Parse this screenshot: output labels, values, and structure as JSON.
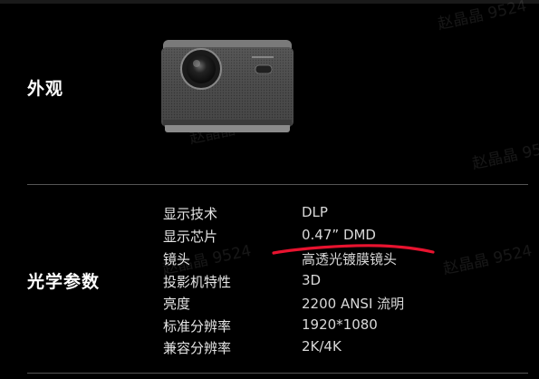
{
  "sections": {
    "appearance_title": "外观",
    "optics_title": "光学参数"
  },
  "specs": [
    {
      "label": "显示技术",
      "value": "DLP"
    },
    {
      "label": "显示芯片",
      "value": "0.47” DMD"
    },
    {
      "label": "镜头",
      "value": "高透光镀膜镜头"
    },
    {
      "label": "投影机特性",
      "value": "3D"
    },
    {
      "label": "亮度",
      "value": "2200 ANSI 流明"
    },
    {
      "label": "标准分辨率",
      "value": "1920*1080"
    },
    {
      "label": "兼容分辨率",
      "value": "2K/4K"
    }
  ],
  "watermarks": [
    "赵晶晶 9524",
    "赵晶晶 9524",
    "赵晶晶 9524",
    "赵晶晶 9524",
    "赵晶晶 9524"
  ],
  "colors": {
    "background": "#000000",
    "annotation": "#e8132f"
  }
}
